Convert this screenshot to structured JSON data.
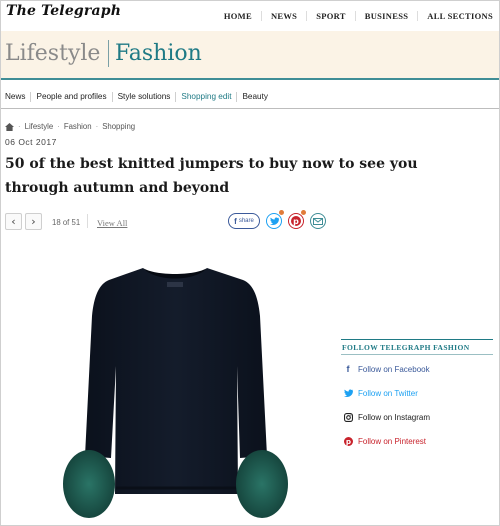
{
  "header": {
    "logo": "The Telegraph",
    "nav": [
      "HOME",
      "NEWS",
      "SPORT",
      "BUSINESS",
      "ALL SECTIONS"
    ]
  },
  "section": {
    "parent": "Lifestyle",
    "current": "Fashion"
  },
  "subnav": {
    "items": [
      "News",
      "People and profiles",
      "Style solutions",
      "Shopping edit",
      "Beauty"
    ],
    "active": "Shopping edit"
  },
  "breadcrumb": [
    "Lifestyle",
    "Fashion",
    "Shopping"
  ],
  "article": {
    "date": "06 Oct 2017",
    "headline": "50 of the best knitted jumpers to buy now to see you through autumn and beyond"
  },
  "gallery": {
    "prev_icon": "chevron-left-icon",
    "next_icon": "chevron-right-icon",
    "counter": "18 of 51",
    "view_all": "View All"
  },
  "share": {
    "facebook_label": "share",
    "icons": [
      "facebook-share-icon",
      "twitter-icon",
      "pinterest-icon",
      "email-icon"
    ]
  },
  "follow": {
    "title": "FOLLOW TELEGRAPH FASHION",
    "links": [
      {
        "label": "Follow on Facebook",
        "icon": "facebook-icon",
        "color": "#3b5a9a"
      },
      {
        "label": "Follow on Twitter",
        "icon": "twitter-icon",
        "color": "#1da1f2"
      },
      {
        "label": "Follow on Instagram",
        "icon": "instagram-icon",
        "color": "#222222"
      },
      {
        "label": "Follow on Pinterest",
        "icon": "pinterest-icon",
        "color": "#c8232c"
      }
    ]
  },
  "colors": {
    "accent": "#1f7a85",
    "section_bg": "#fbf3e6",
    "jumper": "#0e1522",
    "fur_cuff": "#1e5a50"
  }
}
